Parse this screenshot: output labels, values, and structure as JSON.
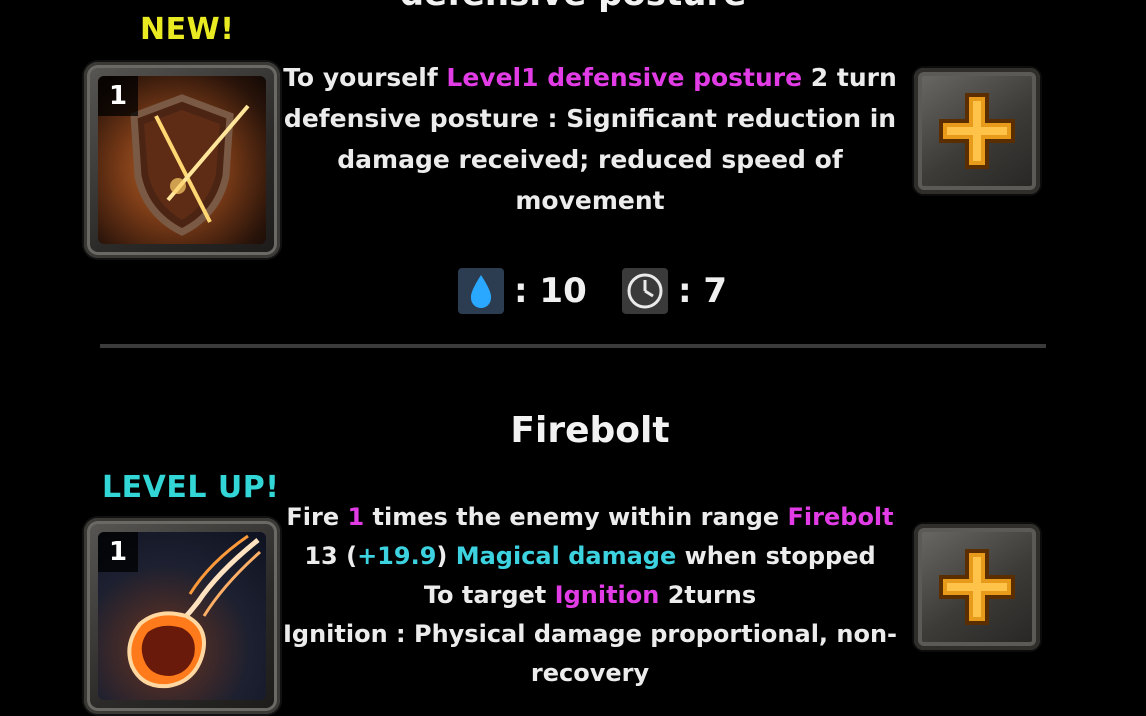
{
  "colors": {
    "badge_new": "#eaea22",
    "badge_level_up": "#33d6d6",
    "highlight_pink": "#e23ce6",
    "highlight_cyan": "#3cd2e0",
    "background": "#000000"
  },
  "skill_cut": {
    "title": "defensive posture"
  },
  "skill1": {
    "badge": "NEW!",
    "level": "1",
    "icon": "shield-slash-icon",
    "desc": {
      "l1a": "To yourself ",
      "l1b": "Level1 defensive posture",
      "l1c": " 2 turn",
      "l2": "defensive posture : Significant reduction in",
      "l3": "damage received; reduced speed of",
      "l4": "movement"
    },
    "mana_icon": "water-drop-icon",
    "mana_value": ": 10",
    "cooldown_icon": "clock-icon",
    "cooldown_value": ": 7",
    "plus_icon": "plus-icon"
  },
  "skill2": {
    "title": "Firebolt",
    "badge": "LEVEL UP!",
    "level": "1",
    "icon": "firebolt-icon",
    "desc": {
      "l1a": "Fire ",
      "l1b": "1",
      "l1c": " times the enemy within range ",
      "l1d": "Firebolt",
      "l2a": "13 (",
      "l2b": "+19.9",
      "l2c": ") ",
      "l2d": "Magical damage",
      "l2e": " when stopped",
      "l3a": "To target ",
      "l3b": "Ignition",
      "l3c": " 2turns",
      "l4": "Ignition : Physical damage proportional, non-",
      "l5": "recovery"
    },
    "plus_icon": "plus-icon"
  }
}
